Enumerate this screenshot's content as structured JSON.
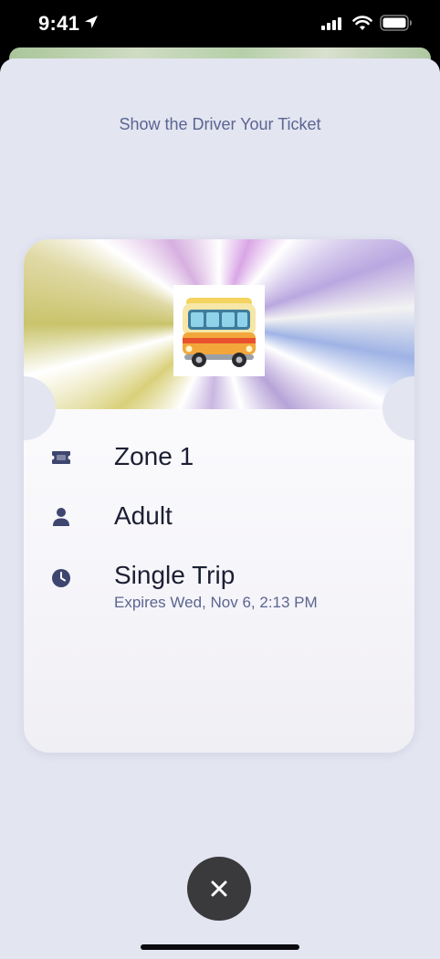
{
  "status_bar": {
    "time": "9:41",
    "icons": [
      "location-arrow-icon",
      "cellular-signal-icon",
      "wifi-icon",
      "battery-icon"
    ]
  },
  "sheet": {
    "prompt": "Show the Driver Your Ticket"
  },
  "ticket": {
    "header_icon": "bus-icon",
    "items": [
      {
        "icon": "ticket-icon",
        "label": "Zone 1"
      },
      {
        "icon": "person-icon",
        "label": "Adult"
      },
      {
        "icon": "clock-icon",
        "label": "Single Trip",
        "sub": "Expires Wed, Nov 6, 2:13 PM"
      }
    ]
  },
  "controls": {
    "close_icon": "close-icon"
  },
  "colors": {
    "sheet_background": "#e3e5f1",
    "accent_text": "#5b6591",
    "primary_text": "#1c1f33",
    "icon_color": "#3e4670",
    "close_button": "#3a393c"
  }
}
